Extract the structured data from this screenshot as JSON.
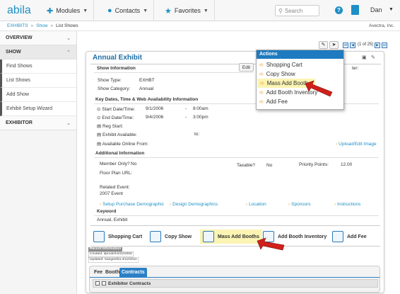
{
  "topbar": {
    "logo": "abila",
    "modules": "Modules",
    "contacts": "Contacts",
    "favorites": "Favorites",
    "search_placeholder": "Search",
    "user": "Dan"
  },
  "breadcrumb": {
    "items": [
      "EXHIBITS",
      "Show",
      "List Shows"
    ],
    "separator": "»",
    "company": "Avectra, Inc."
  },
  "sidebar": {
    "overview": "OVERVIEW",
    "show": "SHOW",
    "items": [
      "Find Shows",
      "List Shows",
      "Add Show",
      "Exhibit Setup Wizard"
    ],
    "exhibitor": "EXHIBITOR"
  },
  "pager": {
    "text": "(1 of 25)"
  },
  "card": {
    "title": "Annual Exhibit",
    "edit_label": "Edit",
    "show_info_head": "Show Information",
    "filter_label": "ter:",
    "show_type_label": "Show Type:",
    "show_type_value": "EXHBT",
    "show_category_label": "Show Category:",
    "show_category_value": "Annual",
    "key_dates_head": "Key Dates, Time & Web Availability Information",
    "start_label": "Start Date/Time:",
    "start_date": "9/1/2006",
    "start_time": "8:00am",
    "end_label": "End Date/Time:",
    "end_date": "9/4/2006",
    "end_time": "3:00pm",
    "dash": "-",
    "reg_start_label": "Reg Start:",
    "exhibit_available_label": "Exhibit Available:",
    "to_label": "to:",
    "available_online_label": "Available Online From:",
    "upload_link": "Upload/Edit Image",
    "additional_head": "Additional Information",
    "member_only_label": "Member Only?",
    "member_only_value": "No",
    "taxable_label": "Taxable?",
    "taxable_value": "No",
    "priority_label": "Priority Points:",
    "priority_value": "12.00",
    "floor_plan_label": "Floor Plan URL:",
    "related_event_label": "Related Event:",
    "related_event_value": "2007 Event",
    "links": [
      "Setup Purchase Demographic",
      "Design Demographics",
      "Location",
      "Sponsors",
      "Instructions"
    ],
    "keyword_head": "Keyword",
    "keyword_value": "Annual, Exhibit"
  },
  "actions_menu": {
    "title": "Actions",
    "items": [
      "Shopping Cart",
      "Copy Show",
      "Mass Add Booth",
      "Add Booth Inventory",
      "Add Fee"
    ]
  },
  "action_bar": {
    "items": [
      "Shopping Cart",
      "Copy Show",
      "Mass Add Booths",
      "Add Booth Inventory",
      "Add Fee"
    ]
  },
  "record_info": {
    "title": "Record Information",
    "created": "Created: dprodell-6/22/2006",
    "updated": "Updated: Sangeetha-4/12/2011"
  },
  "bottom_tabs": {
    "tabs": [
      "Fee",
      "Booth",
      "Contracts"
    ],
    "section": "Exhibitor Contracts"
  },
  "colors": {
    "brand": "#1e8fc6",
    "title_blue": "#1d6fa5",
    "highlight": "#fbf4b3",
    "arrow_orange": "#e9a02b",
    "annotation_red": "#d0201a"
  }
}
